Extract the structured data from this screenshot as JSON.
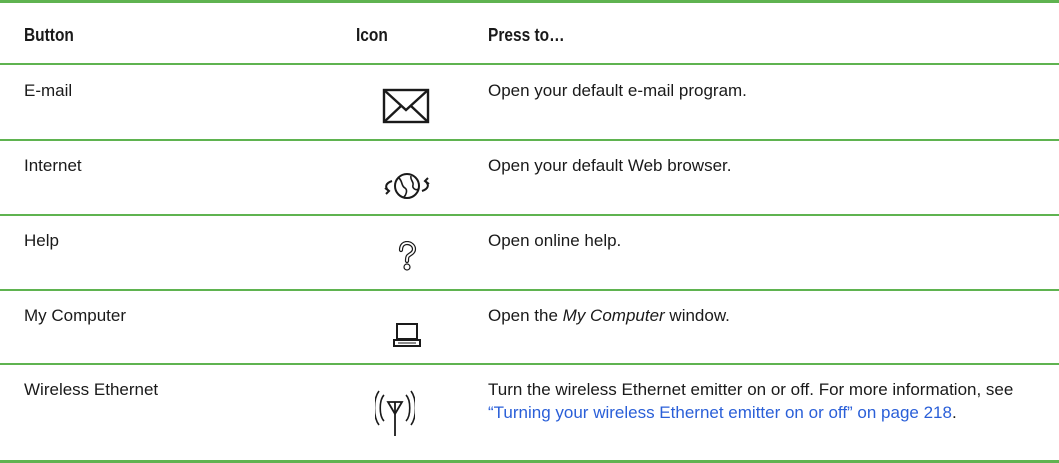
{
  "header": {
    "button": "Button",
    "icon": "Icon",
    "press_to": "Press to…"
  },
  "rows": [
    {
      "button": "E-mail",
      "icon": "envelope-icon",
      "press": "Open your default e-mail program."
    },
    {
      "button": "Internet",
      "icon": "globe-arrows-icon",
      "press": "Open your default Web browser."
    },
    {
      "button": "Help",
      "icon": "question-mark-icon",
      "press": "Open online help."
    },
    {
      "button": "My Computer",
      "icon": "laptop-icon",
      "press_before": "Open the ",
      "press_em": "My Computer",
      "press_after": " window."
    },
    {
      "button": "Wireless Ethernet",
      "icon": "wireless-antenna-icon",
      "press_before": "Turn the wireless Ethernet emitter on or off. For more information, see ",
      "press_link": "“Turning your wireless Ethernet emitter on or off” on page 218",
      "press_after": "."
    }
  ],
  "colors": {
    "rule": "#5fb350",
    "link": "#2a5fd8",
    "text": "#1a1a1a"
  }
}
